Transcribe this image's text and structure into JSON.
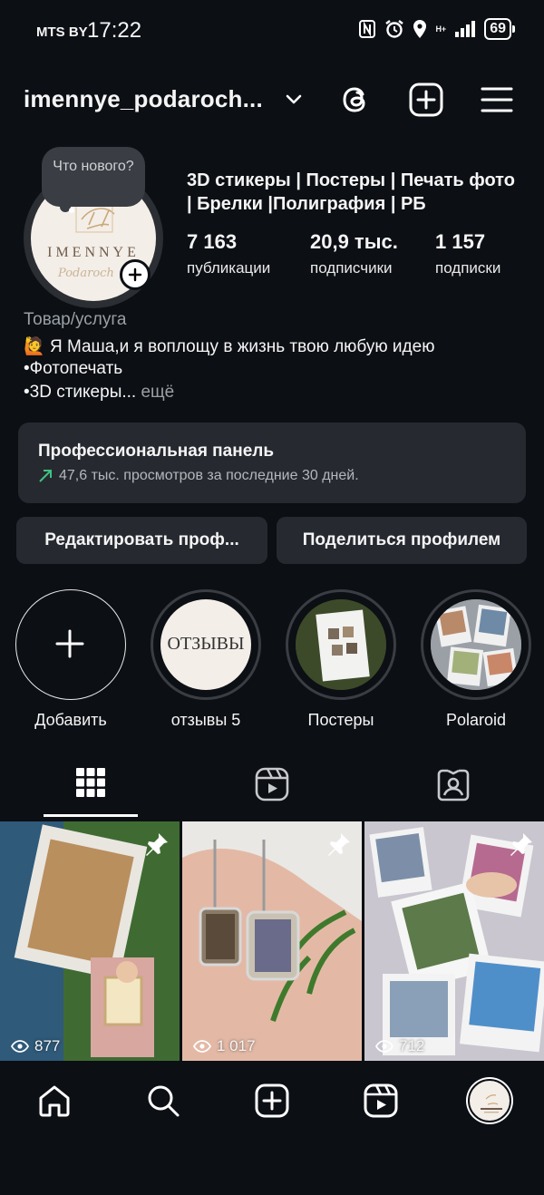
{
  "status": {
    "carrier": "MTS BY",
    "time": "17:22",
    "network": "H+",
    "battery": "69"
  },
  "profile": {
    "username": "imennye_podaroch...",
    "note": "Что нового?",
    "avatar_brand": "IMENNYE",
    "avatar_script": "Podaroch",
    "bio_title": "3D стикеры | Постеры | Печать фото | Брелки |Полиграфия | РБ",
    "stats": [
      {
        "value": "7 163",
        "label": "публикации"
      },
      {
        "value": "20,9 тыс.",
        "label": "подписчики"
      },
      {
        "value": "1 157",
        "label": "подписки"
      }
    ],
    "category": "Товар/услуга",
    "bio_emoji": "🙋",
    "bio_lines": [
      "Я Маша,и я воплощу в жизнь твою любую идею",
      "•Фотопечать",
      "•3D стикеры..."
    ],
    "more": "ещё"
  },
  "pro_panel": {
    "title": "Профессиональная панель",
    "subtitle": "47,6 тыс. просмотров за последние 30 дней."
  },
  "buttons": {
    "edit": "Редактировать проф...",
    "share": "Поделиться профилем"
  },
  "highlights": [
    {
      "label": "Добавить",
      "icon": "plus-icon"
    },
    {
      "label": "отзывы 5",
      "cover_text": "ОТЗЫВЫ"
    },
    {
      "label": "Постеры"
    },
    {
      "label": "Polaroid"
    }
  ],
  "tabs": [
    "grid-icon",
    "reels-icon",
    "tagged-icon"
  ],
  "posts": [
    {
      "views": "877",
      "pinned": true
    },
    {
      "views": "1 017",
      "pinned": true
    },
    {
      "views": "712",
      "pinned": true
    }
  ],
  "colors": {
    "background": "#0c0f14",
    "panel": "#262a30",
    "accent_green": "#3fc380",
    "muted": "#9aa0a6"
  }
}
